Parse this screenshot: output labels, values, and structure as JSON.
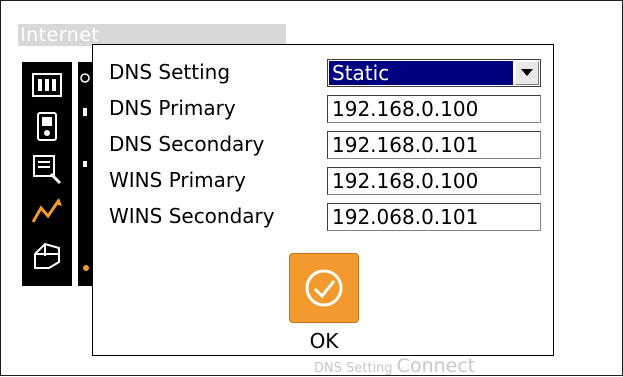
{
  "window": {
    "title": "Internet"
  },
  "background": {
    "footer_small": "DNS Setting",
    "footer_big": "Connect"
  },
  "toolbar": {
    "icons": [
      "network-card-icon",
      "device-icon",
      "document-search-icon",
      "signal-graph-icon",
      "hand-device-icon"
    ]
  },
  "dialog": {
    "rows": [
      {
        "label": "DNS Setting",
        "value": "Static",
        "type": "select"
      },
      {
        "label": "DNS Primary",
        "value": "192.168.0.100",
        "type": "text"
      },
      {
        "label": "DNS Secondary",
        "value": "192.168.0.101",
        "type": "text"
      },
      {
        "label": "WINS Primary",
        "value": "192.168.0.100",
        "type": "text"
      },
      {
        "label": "WINS Secondary",
        "value": "192.068.0.101",
        "type": "text"
      }
    ],
    "ok_label": "OK"
  },
  "colors": {
    "selection": "#000080",
    "ok_button": "#f29a2e",
    "toolbar": "#000000"
  }
}
